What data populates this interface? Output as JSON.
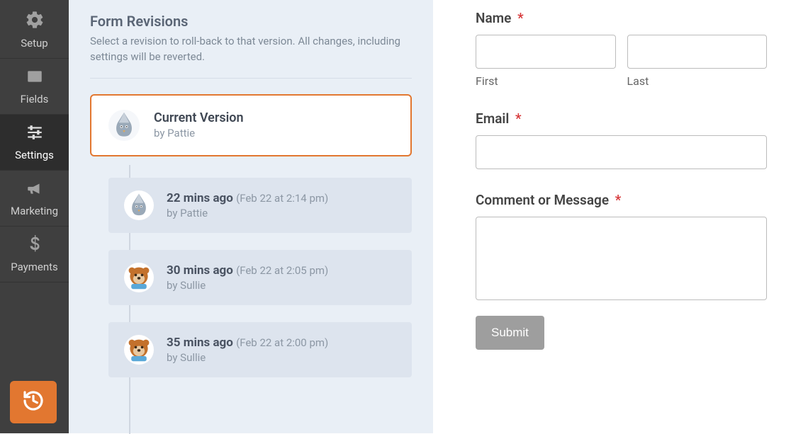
{
  "sidebar": {
    "items": [
      {
        "label": "Setup"
      },
      {
        "label": "Fields"
      },
      {
        "label": "Settings"
      },
      {
        "label": "Marketing"
      },
      {
        "label": "Payments"
      }
    ],
    "history_button": "Form Revisions"
  },
  "revisions": {
    "title": "Form Revisions",
    "description": "Select a revision to roll-back to that version. All changes, including settings will be reverted.",
    "current": {
      "title": "Current Version",
      "byline": "by Pattie",
      "avatar": "pigeon"
    },
    "list": [
      {
        "ago": "22 mins ago",
        "timestamp": "(Feb 22 at 2:14 pm)",
        "byline": "by Pattie",
        "avatar": "pigeon"
      },
      {
        "ago": "30 mins ago",
        "timestamp": "(Feb 22 at 2:05 pm)",
        "byline": "by Sullie",
        "avatar": "bear"
      },
      {
        "ago": "35 mins ago",
        "timestamp": "(Feb 22 at 2:00 pm)",
        "byline": "by Sullie",
        "avatar": "bear"
      }
    ]
  },
  "form": {
    "name_label": "Name",
    "first_sublabel": "First",
    "last_sublabel": "Last",
    "email_label": "Email",
    "comment_label": "Comment or Message",
    "submit_label": "Submit",
    "required_mark": "*"
  },
  "colors": {
    "accent": "#e27730",
    "sidebar_bg": "#3f3f3f",
    "panel_bg": "#e9eff6"
  }
}
